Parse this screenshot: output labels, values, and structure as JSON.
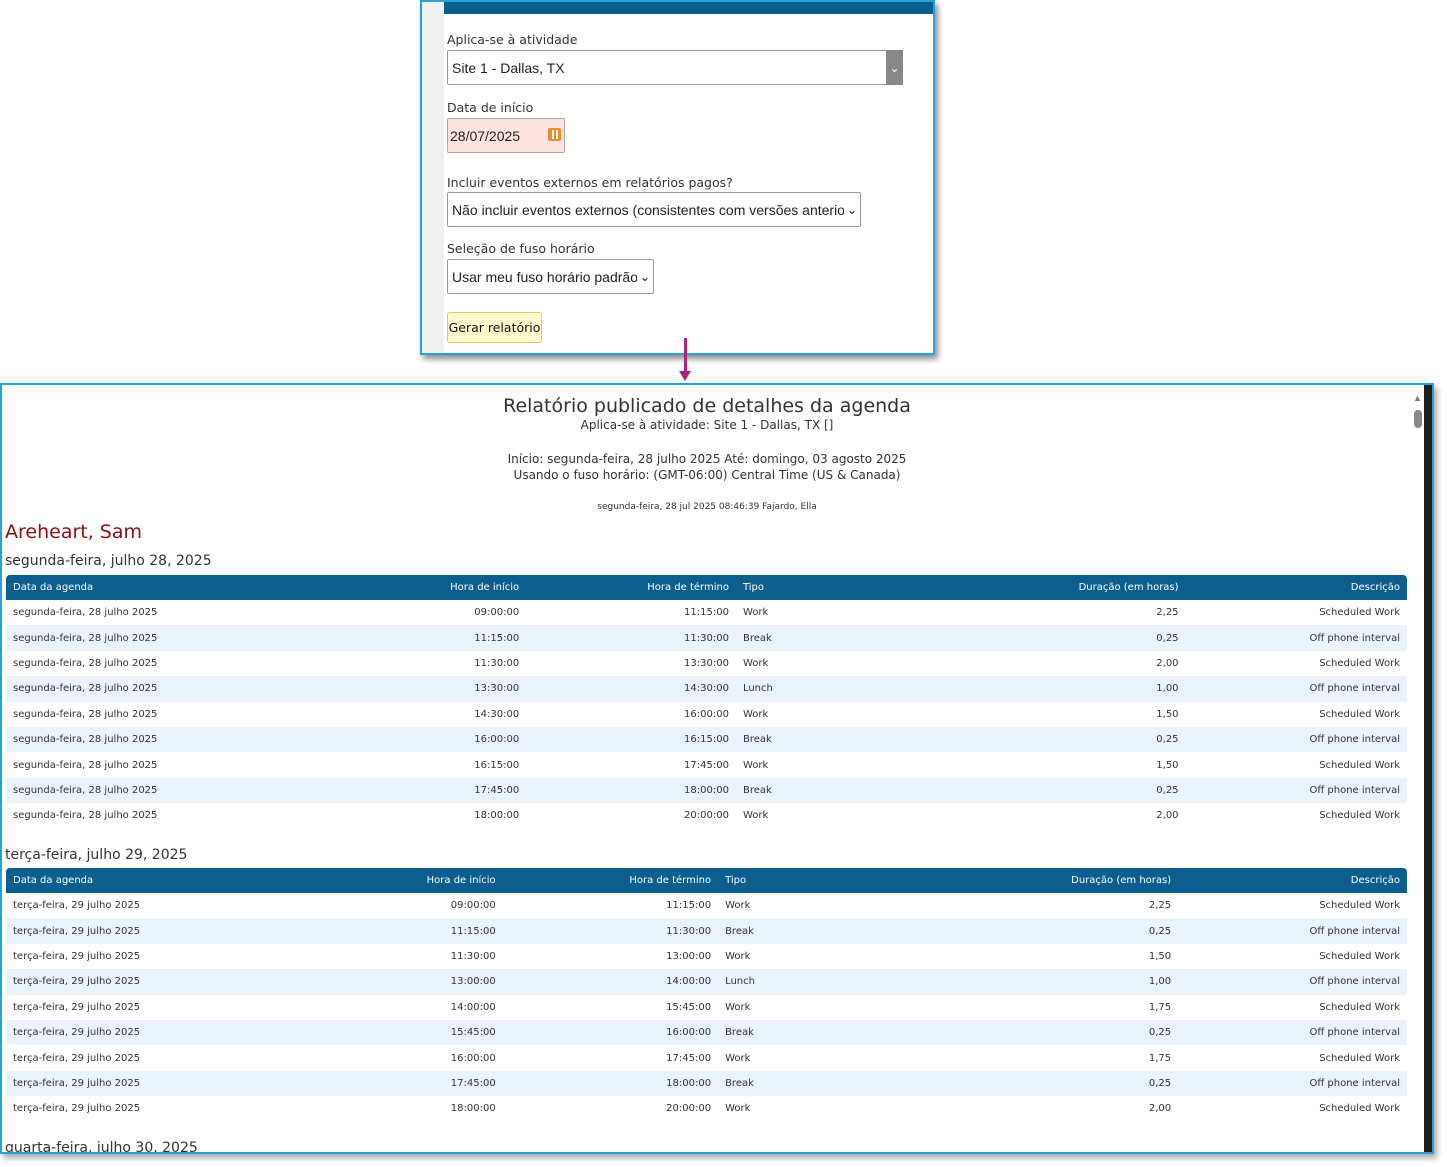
{
  "form": {
    "activity_label": "Aplica-se à atividade",
    "activity_value": "Site 1 - Dallas, TX",
    "start_label": "Data de início",
    "start_value": "28/07/2025",
    "external_label": "Incluir eventos externos em relatórios pagos?",
    "external_value": "Não incluir eventos externos (consistentes com versões anteriores)",
    "tz_label": "Seleção de fuso horário",
    "tz_value": "Usar meu fuso horário padrão",
    "generate_label": "Gerar relatório"
  },
  "report": {
    "title": "Relatório publicado de detalhes da agenda",
    "applies_to": "Aplica-se à atividade: Site 1 - Dallas, TX []",
    "range": "Início: segunda-feira, 28 julho 2025 Até: domingo, 03 agosto 2025",
    "timezone": "Usando o fuso horário: (GMT-06:00) Central Time (US & Canada)",
    "generated": "segunda-feira, 28 jul 2025 08:46:39  Fajardo, Ella",
    "person": "Areheart, Sam",
    "columns": [
      "Data da agenda",
      "Hora de início",
      "Hora de término",
      "Tipo",
      "Duração (em horas)",
      "Descrição"
    ],
    "days": [
      {
        "heading": "segunda-feira, julho 28, 2025",
        "rows": [
          [
            "segunda-feira, 28 julho 2025",
            "09:00:00",
            "11:15:00",
            "Work",
            "2,25",
            "Scheduled Work"
          ],
          [
            "segunda-feira, 28 julho 2025",
            "11:15:00",
            "11:30:00",
            "Break",
            "0,25",
            "Off phone interval"
          ],
          [
            "segunda-feira, 28 julho 2025",
            "11:30:00",
            "13:30:00",
            "Work",
            "2,00",
            "Scheduled Work"
          ],
          [
            "segunda-feira, 28 julho 2025",
            "13:30:00",
            "14:30:00",
            "Lunch",
            "1,00",
            "Off phone interval"
          ],
          [
            "segunda-feira, 28 julho 2025",
            "14:30:00",
            "16:00:00",
            "Work",
            "1,50",
            "Scheduled Work"
          ],
          [
            "segunda-feira, 28 julho 2025",
            "16:00:00",
            "16:15:00",
            "Break",
            "0,25",
            "Off phone interval"
          ],
          [
            "segunda-feira, 28 julho 2025",
            "16:15:00",
            "17:45:00",
            "Work",
            "1,50",
            "Scheduled Work"
          ],
          [
            "segunda-feira, 28 julho 2025",
            "17:45:00",
            "18:00:00",
            "Break",
            "0,25",
            "Off phone interval"
          ],
          [
            "segunda-feira, 28 julho 2025",
            "18:00:00",
            "20:00:00",
            "Work",
            "2,00",
            "Scheduled Work"
          ]
        ]
      },
      {
        "heading": "terça-feira, julho 29, 2025",
        "rows": [
          [
            "terça-feira, 29 julho 2025",
            "09:00:00",
            "11:15:00",
            "Work",
            "2,25",
            "Scheduled Work"
          ],
          [
            "terça-feira, 29 julho 2025",
            "11:15:00",
            "11:30:00",
            "Break",
            "0,25",
            "Off phone interval"
          ],
          [
            "terça-feira, 29 julho 2025",
            "11:30:00",
            "13:00:00",
            "Work",
            "1,50",
            "Scheduled Work"
          ],
          [
            "terça-feira, 29 julho 2025",
            "13:00:00",
            "14:00:00",
            "Lunch",
            "1,00",
            "Off phone interval"
          ],
          [
            "terça-feira, 29 julho 2025",
            "14:00:00",
            "15:45:00",
            "Work",
            "1,75",
            "Scheduled Work"
          ],
          [
            "terça-feira, 29 julho 2025",
            "15:45:00",
            "16:00:00",
            "Break",
            "0,25",
            "Off phone interval"
          ],
          [
            "terça-feira, 29 julho 2025",
            "16:00:00",
            "17:45:00",
            "Work",
            "1,75",
            "Scheduled Work"
          ],
          [
            "terça-feira, 29 julho 2025",
            "17:45:00",
            "18:00:00",
            "Break",
            "0,25",
            "Off phone interval"
          ],
          [
            "terça-feira, 29 julho 2025",
            "18:00:00",
            "20:00:00",
            "Work",
            "2,00",
            "Scheduled Work"
          ]
        ]
      },
      {
        "heading": "quarta-feira, julho 30, 2025",
        "rows": []
      }
    ]
  },
  "icons": {
    "select_chevron": "chevron-down-icon",
    "date_picker": "calendar-icon",
    "arrow": "down-arrow-icon"
  },
  "colors": {
    "header_blue": "#0b5e8e",
    "panel_border": "#2aa0d8",
    "person_name": "#8a1010",
    "arrow": "#b0237a",
    "date_bg": "#fde4de",
    "button_bg": "#fffacb",
    "row_alt": "#eaf3fb"
  }
}
